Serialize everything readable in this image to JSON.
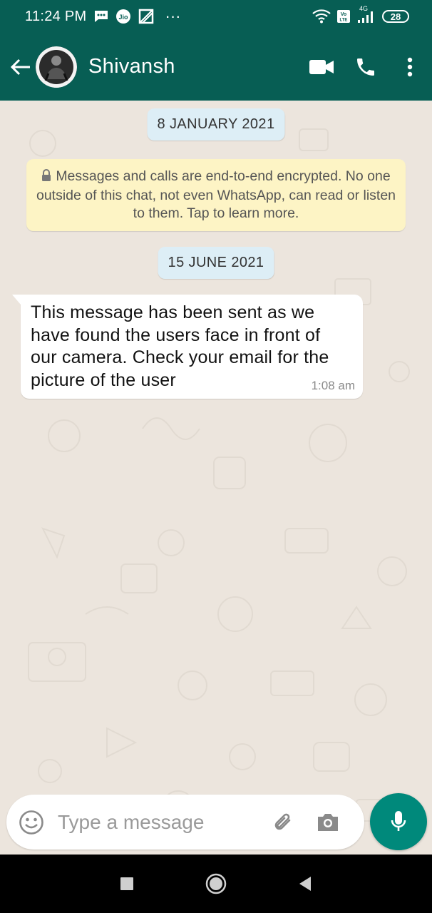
{
  "status_bar": {
    "time": "11:24 PM",
    "dots": "···",
    "network": "4G",
    "battery": "28",
    "icons": [
      "message-icon",
      "jio-icon",
      "cast-icon",
      "wifi-icon",
      "volte-icon",
      "signal-icon",
      "battery-icon"
    ]
  },
  "header": {
    "contact_name": "Shivansh",
    "icons": [
      "back-arrow-icon",
      "video-call-icon",
      "phone-icon",
      "more-vert-icon"
    ]
  },
  "chat": {
    "date_1": "8 JANUARY 2021",
    "encryption_note": "Messages and calls are end-to-end encrypted. No one outside of this chat, not even WhatsApp, can read or listen to them. Tap to learn more.",
    "date_2": "15 JUNE 2021",
    "messages": [
      {
        "text": "This message has been sent as we have found the users face in front of our camera. Check your email for the picture of the user",
        "time": "1:08 am",
        "direction": "incoming"
      }
    ]
  },
  "composer": {
    "placeholder": "Type a message",
    "icons": [
      "emoji-icon",
      "attach-icon",
      "camera-icon",
      "mic-icon"
    ]
  },
  "nav_bar": {
    "icons": [
      "recents-icon",
      "home-icon",
      "back-icon"
    ]
  },
  "colors": {
    "header": "#075E54",
    "chat_bg": "#ECE5DD",
    "date_chip": "#DDEEF6",
    "encryption_bg": "#FDF4C5",
    "bubble": "#FFFFFF",
    "mic_button": "#00897B"
  }
}
